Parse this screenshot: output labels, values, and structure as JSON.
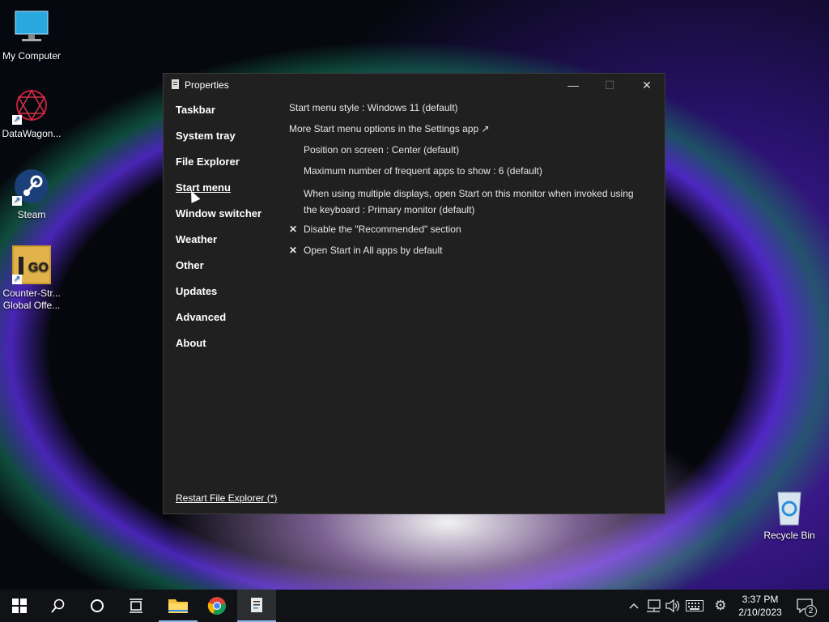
{
  "desktop": {
    "icons": [
      {
        "label": "My Computer"
      },
      {
        "label": "DataWagon..."
      },
      {
        "label": "Steam"
      },
      {
        "label": "Counter-Str... Global Offe..."
      },
      {
        "label": "Recycle Bin"
      }
    ]
  },
  "window": {
    "title": "Properties",
    "controls": {
      "minimize": "—",
      "maximize": "☐",
      "close": "✕"
    },
    "nav": [
      {
        "label": "Taskbar"
      },
      {
        "label": "System tray"
      },
      {
        "label": "File Explorer"
      },
      {
        "label": "Start menu",
        "active": true
      },
      {
        "label": "Window switcher"
      },
      {
        "label": "Weather"
      },
      {
        "label": "Other"
      },
      {
        "label": "Updates"
      },
      {
        "label": "Advanced"
      },
      {
        "label": "About"
      }
    ],
    "settings": {
      "start_menu_style": "Start menu style : Windows 11 (default)",
      "more_options": "More Start menu options in the Settings app ↗",
      "position": "Position on screen : Center (default)",
      "max_frequent": "Maximum number of frequent apps to show : 6 (default)",
      "multi_display": "When using multiple displays, open Start on this monitor when invoked using the keyboard : Primary monitor (default)",
      "disable_recommended": "Disable the \"Recommended\" section",
      "open_all_apps": "Open Start in All apps by default",
      "checkmark": "✕"
    },
    "restart_link": "Restart File Explorer (*)"
  },
  "taskbar": {
    "clock_time": "3:37 PM",
    "clock_date": "2/10/2023",
    "notification_count": "2",
    "accent": "#8fb4e8"
  }
}
